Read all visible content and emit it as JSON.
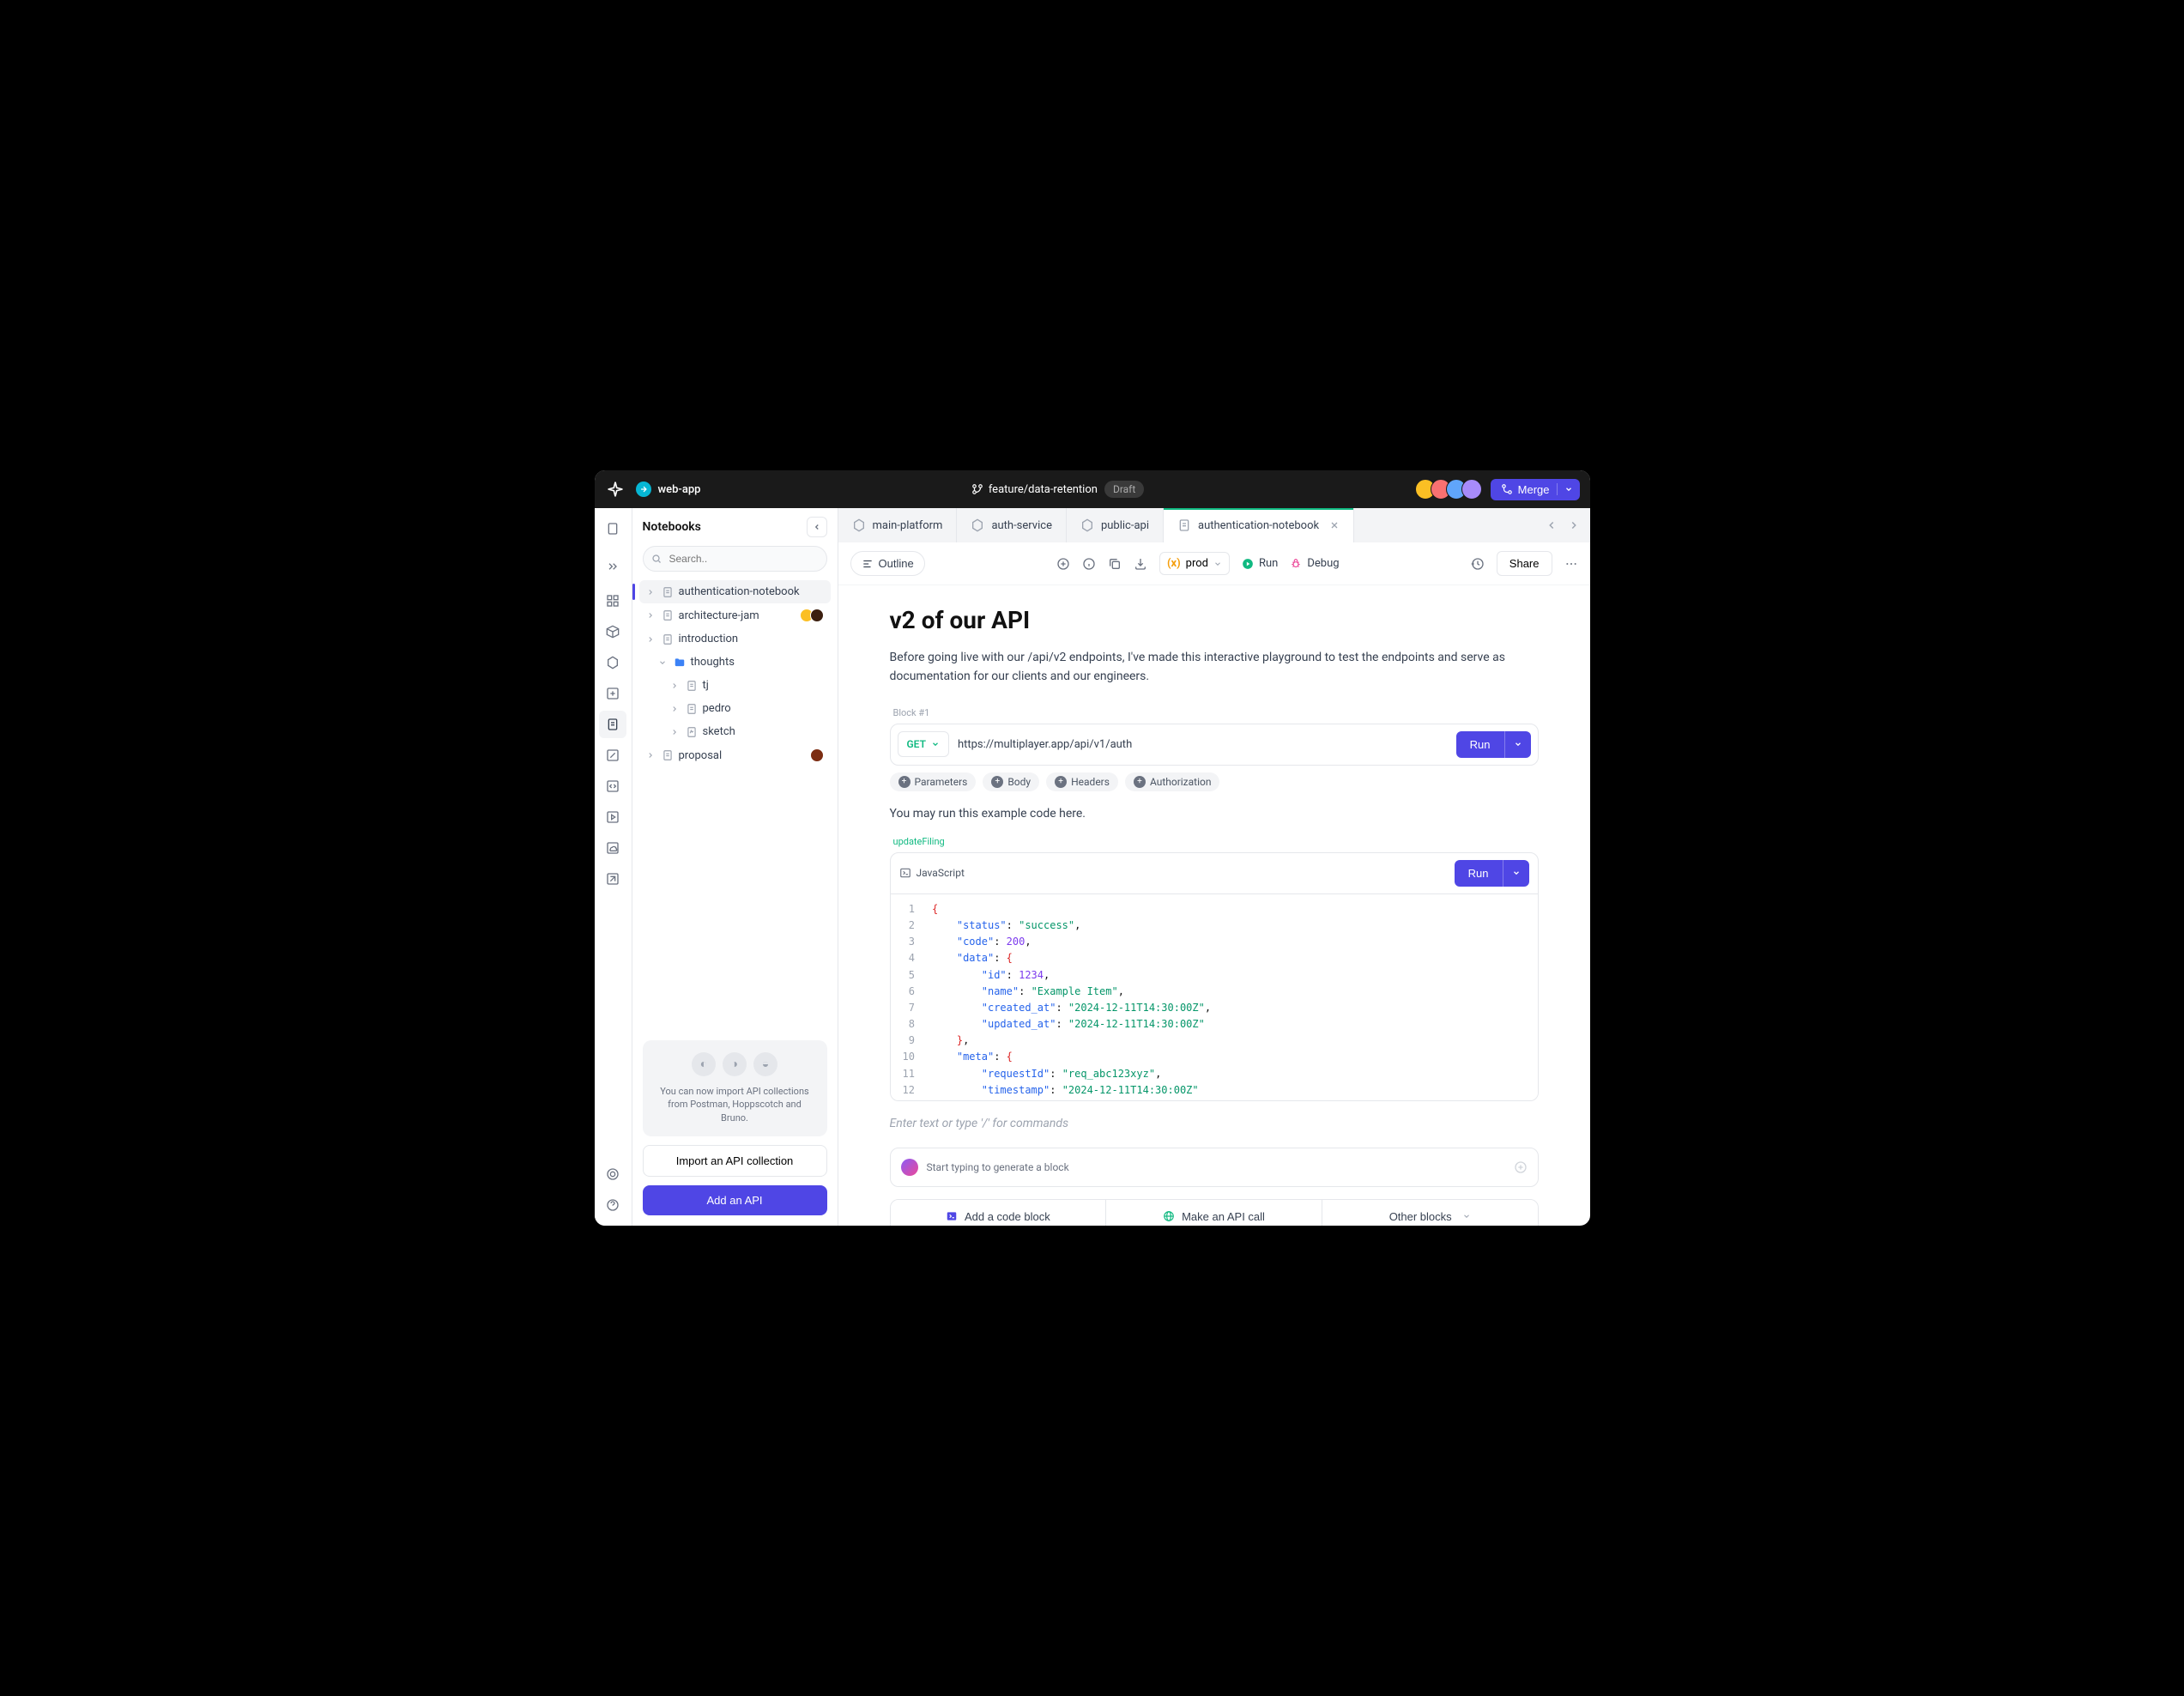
{
  "titlebar": {
    "app_name": "web-app",
    "branch": "feature/data-retention",
    "status_badge": "Draft",
    "merge_label": "Merge"
  },
  "rail": {
    "icons": [
      "file-icon",
      "collapse-icon",
      "grid-icon",
      "cube-icon",
      "hex-icon",
      "square-plus-icon",
      "doc-icon",
      "pencil-icon",
      "code-icon",
      "play-icon",
      "cloud-icon",
      "link-icon"
    ]
  },
  "sidebar": {
    "title": "Notebooks",
    "search_placeholder": "Search..",
    "items": [
      {
        "label": "authentication-notebook",
        "active": true,
        "type": "doc"
      },
      {
        "label": "architecture-jam",
        "type": "doc",
        "avatars": 2
      },
      {
        "label": "introduction",
        "type": "doc"
      },
      {
        "label": "thoughts",
        "type": "folder",
        "expanded": true
      },
      {
        "label": "tj",
        "type": "doc",
        "indent": 2
      },
      {
        "label": "pedro",
        "type": "doc",
        "indent": 2
      },
      {
        "label": "sketch",
        "type": "sketch",
        "indent": 2
      },
      {
        "label": "proposal",
        "type": "doc",
        "avatar": 1
      }
    ],
    "import_card_text": "You can now import API collections from Postman, Hoppscotch and Bruno.",
    "import_btn": "Import an API collection",
    "add_btn": "Add an API"
  },
  "tabs": [
    {
      "label": "main-platform",
      "icon": "hex"
    },
    {
      "label": "auth-service",
      "icon": "hex"
    },
    {
      "label": "public-api",
      "icon": "hex"
    },
    {
      "label": "authentication-notebook",
      "icon": "doc",
      "active": true
    }
  ],
  "toolbar": {
    "outline": "Outline",
    "env": "prod",
    "run": "Run",
    "debug": "Debug",
    "share": "Share"
  },
  "document": {
    "title": "v2 of our API",
    "intro": "Before going live with our /api/v2 endpoints, I've made this interactive playground to test the endpoints and serve as documentation for our clients and our engineers.",
    "block1_label": "Block #1",
    "api": {
      "method": "GET",
      "url": "https://multiplayer.app/api/v1/auth",
      "run": "Run",
      "chips": [
        "Parameters",
        "Body",
        "Headers",
        "Authorization"
      ]
    },
    "run_note": "You may run this example code here.",
    "func_label": "updateFiling",
    "code_lang": "JavaScript",
    "code_run": "Run",
    "code_lines": [
      [
        {
          "t": "{",
          "c": "brace"
        }
      ],
      [
        {
          "t": "    ",
          "c": ""
        },
        {
          "t": "\"status\"",
          "c": "key"
        },
        {
          "t": ": ",
          "c": "punct"
        },
        {
          "t": "\"success\"",
          "c": "str"
        },
        {
          "t": ",",
          "c": "punct"
        }
      ],
      [
        {
          "t": "    ",
          "c": ""
        },
        {
          "t": "\"code\"",
          "c": "key"
        },
        {
          "t": ": ",
          "c": "punct"
        },
        {
          "t": "200",
          "c": "num"
        },
        {
          "t": ",",
          "c": "punct"
        }
      ],
      [
        {
          "t": "    ",
          "c": ""
        },
        {
          "t": "\"data\"",
          "c": "key"
        },
        {
          "t": ": ",
          "c": "punct"
        },
        {
          "t": "{",
          "c": "brace"
        }
      ],
      [
        {
          "t": "        ",
          "c": ""
        },
        {
          "t": "\"id\"",
          "c": "key"
        },
        {
          "t": ": ",
          "c": "punct"
        },
        {
          "t": "1234",
          "c": "num"
        },
        {
          "t": ",",
          "c": "punct"
        }
      ],
      [
        {
          "t": "        ",
          "c": ""
        },
        {
          "t": "\"name\"",
          "c": "key"
        },
        {
          "t": ": ",
          "c": "punct"
        },
        {
          "t": "\"Example Item\"",
          "c": "str"
        },
        {
          "t": ",",
          "c": "punct"
        }
      ],
      [
        {
          "t": "        ",
          "c": ""
        },
        {
          "t": "\"created_at\"",
          "c": "key"
        },
        {
          "t": ": ",
          "c": "punct"
        },
        {
          "t": "\"2024-12-11T14:30:00Z\"",
          "c": "str"
        },
        {
          "t": ",",
          "c": "punct"
        }
      ],
      [
        {
          "t": "        ",
          "c": ""
        },
        {
          "t": "\"updated_at\"",
          "c": "key"
        },
        {
          "t": ": ",
          "c": "punct"
        },
        {
          "t": "\"2024-12-11T14:30:00Z\"",
          "c": "str"
        }
      ],
      [
        {
          "t": "    ",
          "c": ""
        },
        {
          "t": "}",
          "c": "brace"
        },
        {
          "t": ",",
          "c": "punct"
        }
      ],
      [
        {
          "t": "    ",
          "c": ""
        },
        {
          "t": "\"meta\"",
          "c": "key"
        },
        {
          "t": ": ",
          "c": "punct"
        },
        {
          "t": "{",
          "c": "brace"
        }
      ],
      [
        {
          "t": "        ",
          "c": ""
        },
        {
          "t": "\"requestId\"",
          "c": "key"
        },
        {
          "t": ": ",
          "c": "punct"
        },
        {
          "t": "\"req_abc123xyz\"",
          "c": "str"
        },
        {
          "t": ",",
          "c": "punct"
        }
      ],
      [
        {
          "t": "        ",
          "c": ""
        },
        {
          "t": "\"timestamp\"",
          "c": "key"
        },
        {
          "t": ": ",
          "c": "punct"
        },
        {
          "t": "\"2024-12-11T14:30:00Z\"",
          "c": "str"
        }
      ],
      [
        {
          "t": "    ",
          "c": ""
        },
        {
          "t": "}",
          "c": "brace"
        }
      ],
      [
        {
          "t": "}",
          "c": "brace"
        }
      ]
    ],
    "editor_placeholder": "Enter text or type '/' for commands",
    "ai_placeholder": "Start typing to generate a block",
    "actions": {
      "code": "Add a code block",
      "api": "Make an API call",
      "other": "Other blocks"
    }
  }
}
